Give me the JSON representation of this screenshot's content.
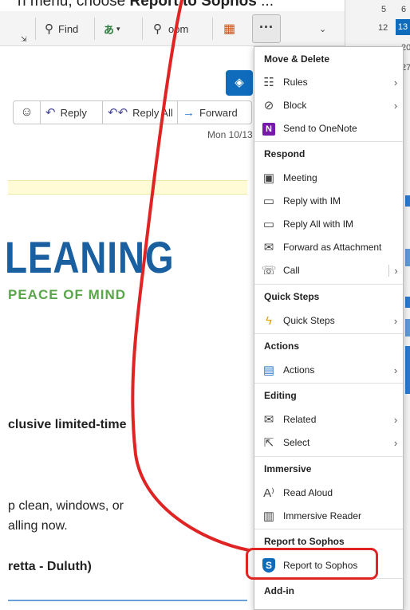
{
  "caption": {
    "prefix": "n menu, choose ",
    "bold": "Report to Sophos",
    "suffix": " ..."
  },
  "toolbar": {
    "find_label": "Find",
    "zoom_label": "oom",
    "translate_icon": "translate-icon",
    "more_label": "···"
  },
  "calendar": {
    "nums": [
      "5",
      "6",
      "12",
      "13",
      "20",
      "27"
    ]
  },
  "email": {
    "reply_label": "Reply",
    "reply_all_label": "Reply All",
    "forward_label": "Forward",
    "date": "Mon 10/13",
    "headline": "LEANING",
    "tagline": "PEACE OF MIND",
    "line1": "clusive limited-time",
    "line2": "p clean, windows, or",
    "line3": "alling now.",
    "line4": "retta - Duluth)"
  },
  "menu": {
    "sections": {
      "move_delete": "Move & Delete",
      "respond": "Respond",
      "quick_steps": "Quick Steps",
      "actions": "Actions",
      "editing": "Editing",
      "immersive": "Immersive",
      "report": "Report to Sophos",
      "addin": "Add-in"
    },
    "items": {
      "rules": "Rules",
      "block": "Block",
      "send_onenote": "Send to OneNote",
      "meeting": "Meeting",
      "reply_im": "Reply with IM",
      "reply_all_im": "Reply All with IM",
      "forward_attachment": "Forward as Attachment",
      "call": "Call",
      "quick_steps": "Quick Steps",
      "actions": "Actions",
      "related": "Related",
      "select": "Select",
      "read_aloud": "Read Aloud",
      "immersive_reader": "Immersive Reader",
      "report_sophos": "Report to Sophos"
    }
  },
  "colors": {
    "accent": "#0f6cbd",
    "annotation": "#e02424",
    "headline": "#1a5fa0",
    "tagline": "#5aa64a"
  }
}
